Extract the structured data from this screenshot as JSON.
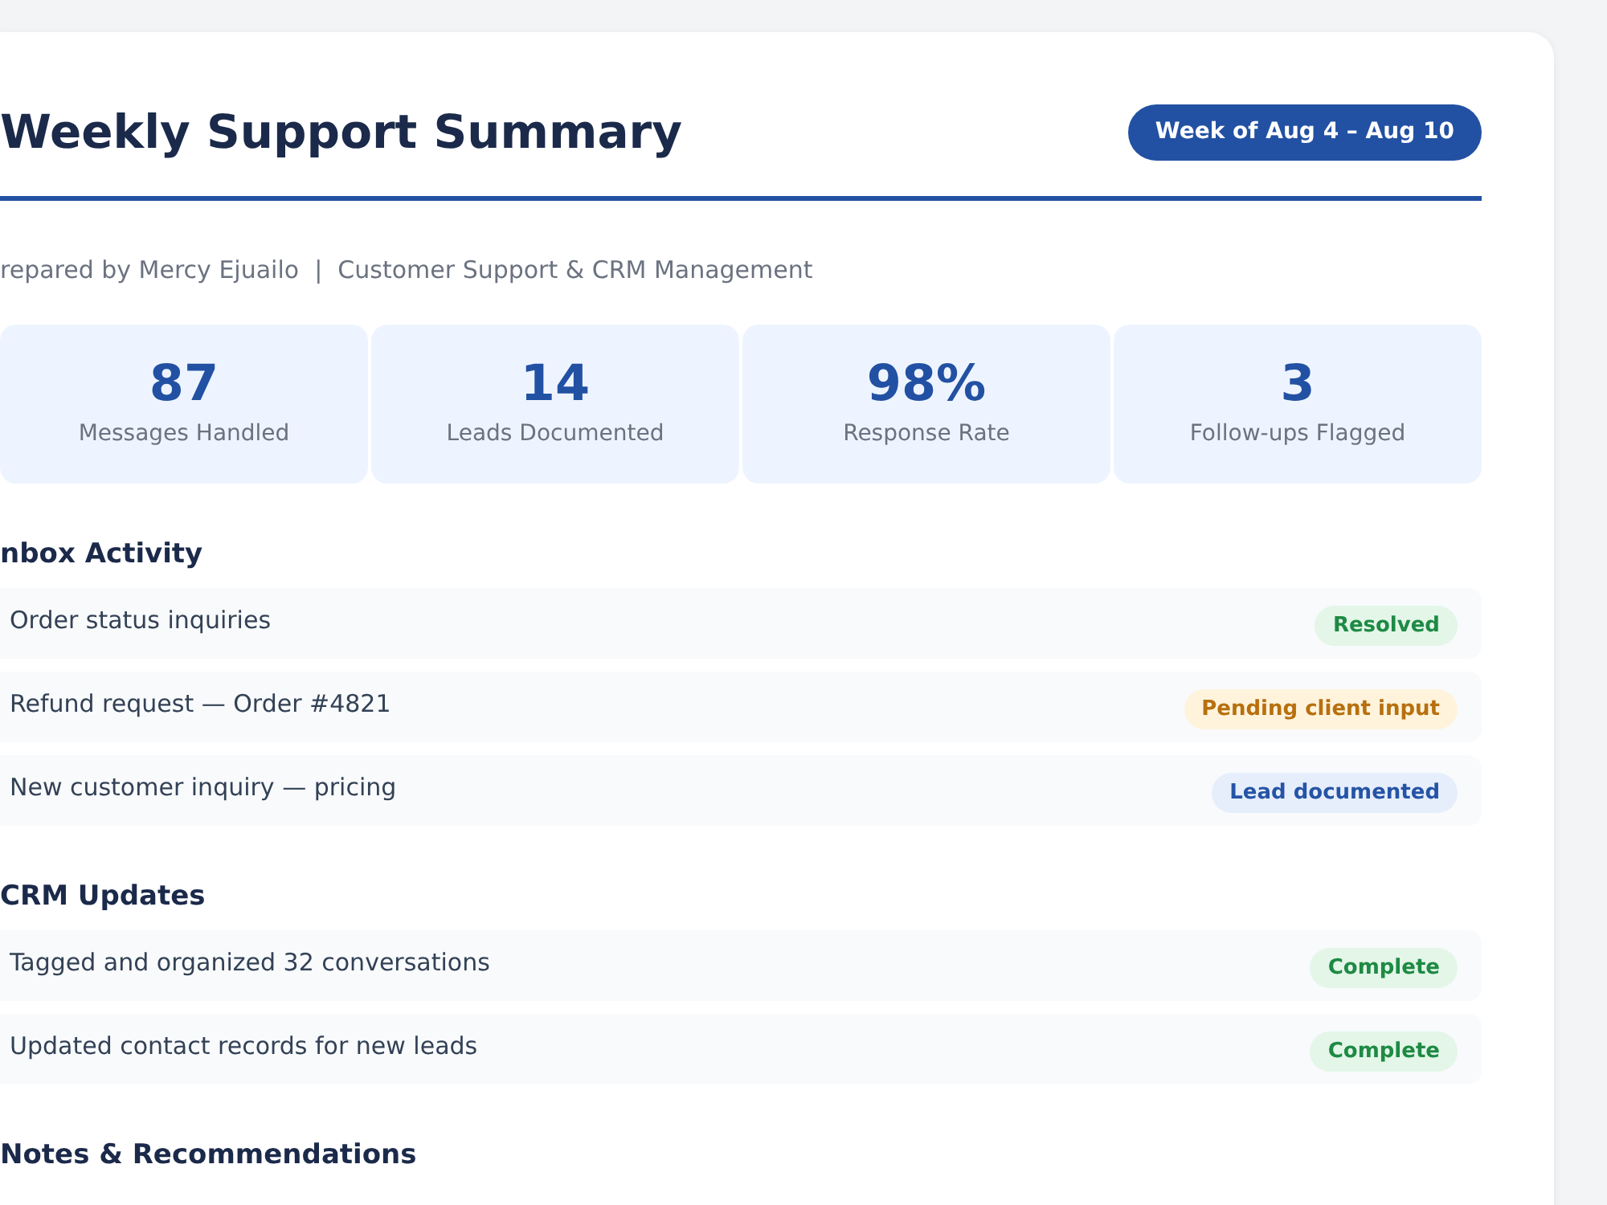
{
  "header": {
    "title": "Weekly Support Summary",
    "week_badge": "Week of Aug 4 – Aug 10"
  },
  "subtitle": "repared by Mercy Ejuailo  |  Customer Support & CRM Management",
  "stats": [
    {
      "value": "87",
      "label": "Messages Handled"
    },
    {
      "value": "14",
      "label": "Leads Documented"
    },
    {
      "value": "98%",
      "label": "Response Rate"
    },
    {
      "value": "3",
      "label": "Follow-ups Flagged"
    }
  ],
  "sections": [
    {
      "title": "nbox Activity",
      "rows": [
        {
          "text": "Order status inquiries",
          "status": "Resolved",
          "kind": "success"
        },
        {
          "text": "Refund request — Order #4821",
          "status": "Pending client input",
          "kind": "pending"
        },
        {
          "text": "New customer inquiry — pricing",
          "status": "Lead documented",
          "kind": "info"
        }
      ]
    },
    {
      "title": "CRM Updates",
      "rows": [
        {
          "text": "Tagged and organized 32 conversations",
          "status": "Complete",
          "kind": "success"
        },
        {
          "text": "Updated contact records for new leads",
          "status": "Complete",
          "kind": "success"
        }
      ]
    },
    {
      "title": "Notes & Recommendations"
    }
  ]
}
